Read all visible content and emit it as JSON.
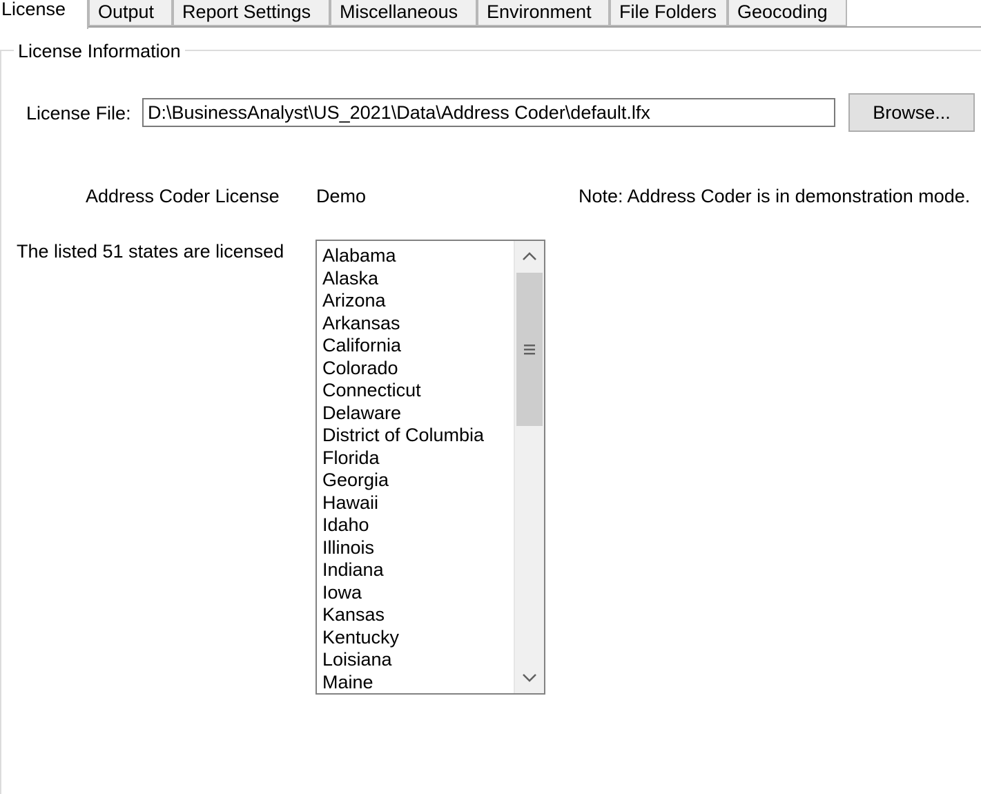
{
  "tabs": [
    {
      "label": "License",
      "active": true
    },
    {
      "label": "Output"
    },
    {
      "label": "Report Settings"
    },
    {
      "label": "Miscellaneous"
    },
    {
      "label": "Environment"
    },
    {
      "label": "File Folders"
    },
    {
      "label": "Geocoding"
    }
  ],
  "group": {
    "title": "License Information"
  },
  "license_file": {
    "label": "License File:",
    "value": "D:\\BusinessAnalyst\\US_2021\\Data\\Address Coder\\default.lfx",
    "browse_label": "Browse..."
  },
  "address_coder": {
    "label": "Address Coder License",
    "value": "Demo",
    "note": "Note: Address Coder is in demonstration mode."
  },
  "states": {
    "label": "The listed 51 states are licensed",
    "items": [
      "Alabama",
      "Alaska",
      "Arizona",
      "Arkansas",
      "California",
      "Colorado",
      "Connecticut",
      "Delaware",
      "District of Columbia",
      "Florida",
      "Georgia",
      "Hawaii",
      "Idaho",
      "Illinois",
      "Indiana",
      "Iowa",
      "Kansas",
      "Kentucky",
      "Loisiana",
      "Maine"
    ]
  },
  "icons": {
    "scroll_up": "chevron-up-icon",
    "scroll_down": "chevron-down-icon",
    "thumb_grip": "grip-icon"
  }
}
